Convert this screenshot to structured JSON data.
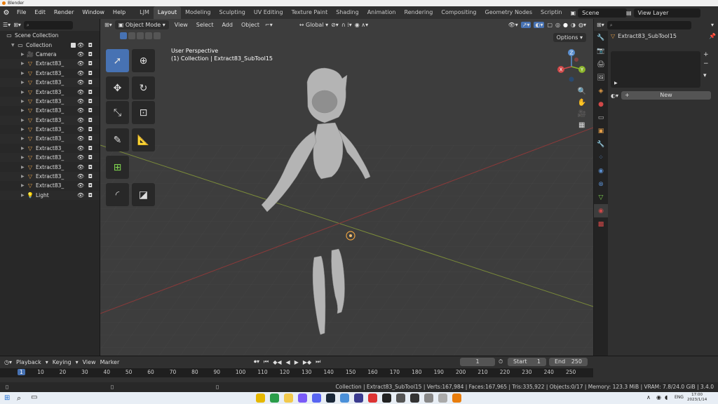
{
  "window": {
    "title": "Blender"
  },
  "menu": {
    "file": "File",
    "edit": "Edit",
    "render": "Render",
    "window": "Window",
    "help": "Help"
  },
  "workspaces": [
    {
      "label": "LJM"
    },
    {
      "label": "Layout"
    },
    {
      "label": "Modeling"
    },
    {
      "label": "Sculpting"
    },
    {
      "label": "UV Editing"
    },
    {
      "label": "Texture Paint"
    },
    {
      "label": "Shading"
    },
    {
      "label": "Animation"
    },
    {
      "label": "Rendering"
    },
    {
      "label": "Compositing"
    },
    {
      "label": "Geometry Nodes"
    },
    {
      "label": "Scriptin"
    }
  ],
  "scene": {
    "name": "Scene",
    "view_layer": "View Layer"
  },
  "outliner": {
    "root": "Scene Collection",
    "collection": "Collection",
    "items": [
      {
        "name": "Camera",
        "type": "camera"
      },
      {
        "name": "Extract83_",
        "type": "mesh"
      },
      {
        "name": "Extract83_",
        "type": "mesh"
      },
      {
        "name": "Extract83_",
        "type": "mesh"
      },
      {
        "name": "Extract83_",
        "type": "mesh"
      },
      {
        "name": "Extract83_",
        "type": "mesh"
      },
      {
        "name": "Extract83_",
        "type": "mesh"
      },
      {
        "name": "Extract83_",
        "type": "mesh"
      },
      {
        "name": "Extract83_",
        "type": "mesh"
      },
      {
        "name": "Extract83_",
        "type": "mesh"
      },
      {
        "name": "Extract83_",
        "type": "mesh"
      },
      {
        "name": "Extract83_",
        "type": "mesh"
      },
      {
        "name": "Extract83_",
        "type": "mesh"
      },
      {
        "name": "Extract83_",
        "type": "mesh"
      },
      {
        "name": "Extract83_",
        "type": "mesh"
      },
      {
        "name": "Light",
        "type": "light"
      }
    ]
  },
  "viewport": {
    "mode": "Object Mode",
    "menus": [
      "View",
      "Select",
      "Add",
      "Object"
    ],
    "orientation": "Global",
    "options": "Options",
    "info_line1": "User Perspective",
    "info_line2": "(1) Collection | Extract83_SubTool15",
    "axes": {
      "x": "X",
      "y": "Y",
      "z": "Z"
    }
  },
  "properties": {
    "object_name": "Extract83_SubTool15",
    "new_button": "New"
  },
  "timeline": {
    "menus": [
      "Playback",
      "Keying",
      "View",
      "Marker"
    ],
    "current_frame": "1",
    "start_label": "Start",
    "start": "1",
    "end_label": "End",
    "end": "250",
    "ticks": [
      "1",
      "10",
      "20",
      "30",
      "40",
      "50",
      "60",
      "70",
      "80",
      "90",
      "100",
      "110",
      "120",
      "130",
      "140",
      "150",
      "160",
      "170",
      "180",
      "190",
      "200",
      "210",
      "220",
      "230",
      "240",
      "250"
    ]
  },
  "status": {
    "text": "Collection | Extract83_SubTool15 | Verts:167,984 | Faces:167,965 | Tris:335,922 | Objects:0/17 | Memory: 123.3 MiB | VRAM: 7.8/24.0 GiB | 3.4.0"
  },
  "taskbar": {
    "lang": "ENG",
    "time": "17:00",
    "date": "2023/1/14"
  },
  "colors": {
    "accent": "#4772b3",
    "mesh_icon": "#e39e48",
    "light_icon": "#e39e48",
    "selected": "#4772b3"
  }
}
